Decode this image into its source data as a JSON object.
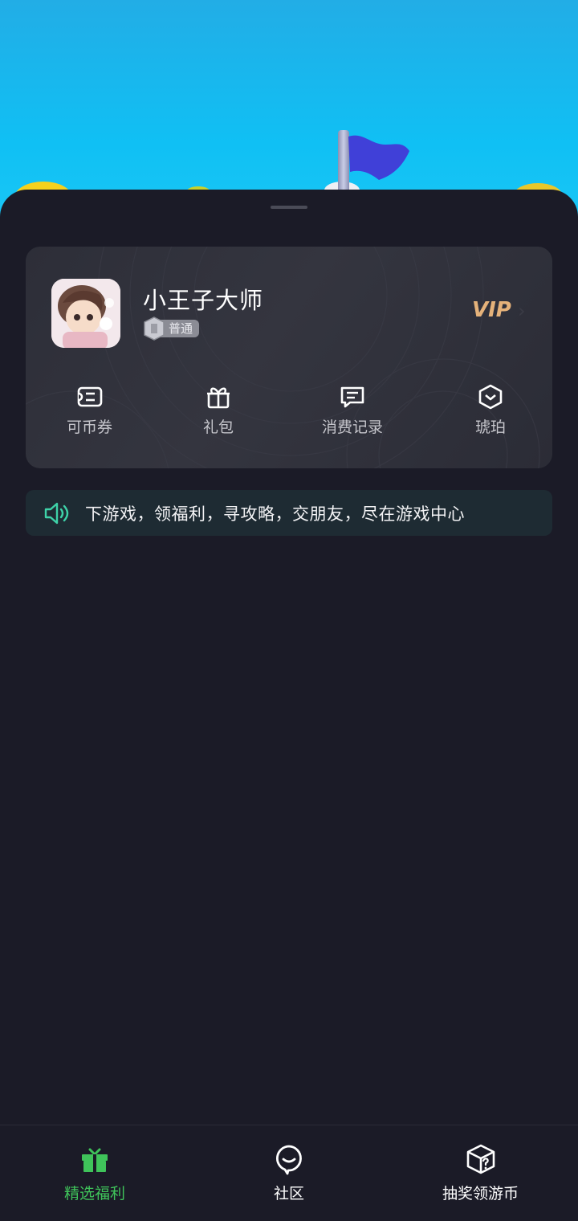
{
  "user": {
    "name": "小王子大师",
    "level": "普通",
    "vip_label": "VIP"
  },
  "quick_actions": [
    {
      "label": "可币券",
      "icon": "ticket-icon"
    },
    {
      "label": "礼包",
      "icon": "gift-icon"
    },
    {
      "label": "消费记录",
      "icon": "message-record-icon"
    },
    {
      "label": "琥珀",
      "icon": "amber-hexagon-icon"
    }
  ],
  "notice": {
    "text": "下游戏，领福利，寻攻略，交朋友，尽在游戏中心",
    "icon": "speaker-icon"
  },
  "bottom_nav": [
    {
      "label": "精选福利",
      "icon": "gift-box-icon",
      "active": true
    },
    {
      "label": "社区",
      "icon": "chat-bubble-icon",
      "active": false
    },
    {
      "label": "抽奖领游币",
      "icon": "mystery-box-icon",
      "active": false
    }
  ],
  "colors": {
    "accent_green": "#3fc35a",
    "vip_gold": "#e5b27a",
    "sheet_bg": "#1b1b27"
  }
}
